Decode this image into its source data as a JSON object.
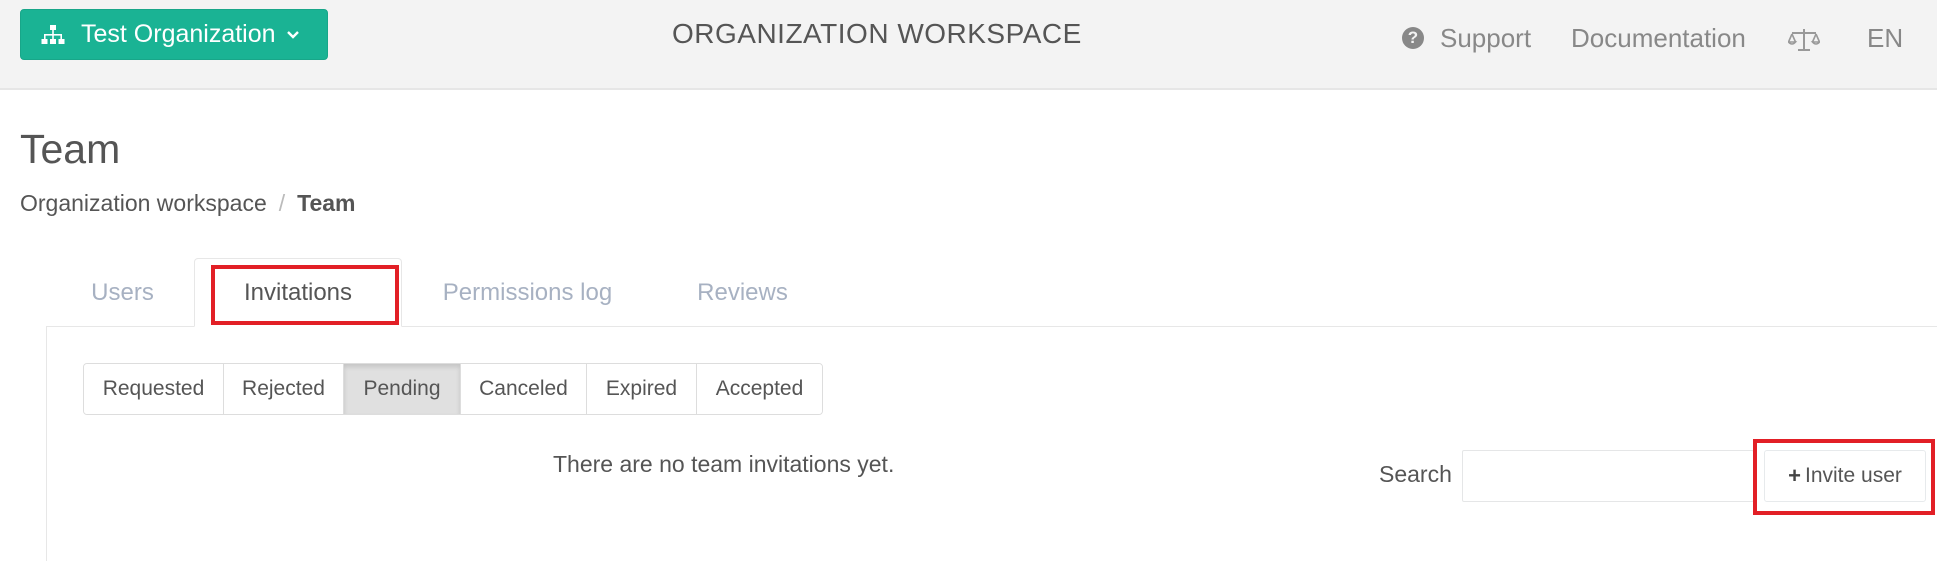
{
  "topbar": {
    "org_button_label": "Test Organization",
    "org_icon": "sitemap-icon",
    "workspace_title": "ORGANIZATION WORKSPACE",
    "nav": {
      "support_label": "Support",
      "documentation_label": "Documentation",
      "terms_icon": "scales-icon",
      "language": "EN"
    }
  },
  "page": {
    "title": "Team",
    "breadcrumb": {
      "parent": "Organization workspace",
      "separator": "/",
      "current": "Team"
    }
  },
  "tabs": [
    {
      "label": "Users"
    },
    {
      "label": "Invitations",
      "active": true
    },
    {
      "label": "Permissions log"
    },
    {
      "label": "Reviews"
    }
  ],
  "status_filter": {
    "options": [
      "Requested",
      "Rejected",
      "Pending",
      "Canceled",
      "Expired",
      "Accepted"
    ],
    "selected": "Pending"
  },
  "empty_message": "There are no team invitations yet.",
  "search": {
    "label": "Search",
    "value": "",
    "placeholder": ""
  },
  "invite_button_label": "Invite user",
  "colors": {
    "brand_green": "#1ab394",
    "highlight_red": "#e21f26",
    "tab_inactive": "#a7b1c2"
  }
}
